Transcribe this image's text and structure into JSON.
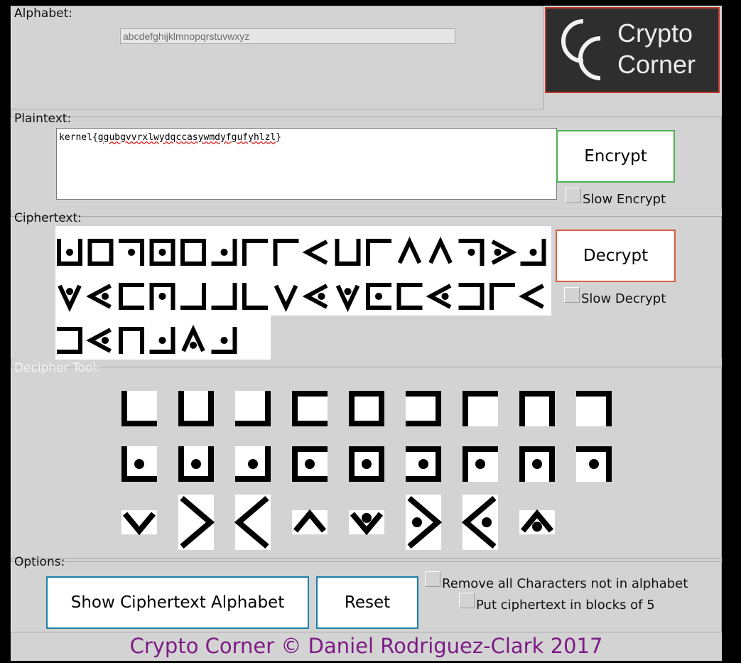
{
  "alphabet": {
    "label": "Alphabet:",
    "value": "abcdefghijklmnopqrstuvwxyz"
  },
  "logo": {
    "line1": "Crypto",
    "line2": "Corner"
  },
  "plaintext": {
    "label": "Plaintext:",
    "prefix": "kernel{",
    "squiggly": "ggubgvvrxlwydqccasywmdyfgufyhlzl",
    "suffix": "}"
  },
  "encrypt": {
    "button": "Encrypt",
    "slow_label": "Slow Encrypt",
    "accent": "#4caf50"
  },
  "ciphertext": {
    "label": "Ciphertext:",
    "text": "kernel{ggubgvvrxlwydqccasywmdyfgufyhlzl}"
  },
  "decrypt": {
    "button": "Decrypt",
    "slow_label": "Slow Decrypt",
    "accent": "#e05a4a"
  },
  "decipher_tool": {
    "label": "Decipher Tool:",
    "rows": [
      [
        "a",
        "b",
        "c",
        "d",
        "e",
        "f",
        "g",
        "h",
        "i"
      ],
      [
        "j",
        "k",
        "l",
        "m",
        "n",
        "o",
        "p",
        "q",
        "r"
      ],
      [
        "s",
        "t",
        "u",
        "v",
        "w",
        "x",
        "y",
        "z"
      ]
    ]
  },
  "options": {
    "label": "Options:",
    "show_alphabet_button": "Show Ciphertext Alphabet",
    "reset_button": "Reset",
    "remove_chars_label": "Remove all Characters not in alphabet",
    "blocks_label": "Put ciphertext in blocks of 5",
    "accent": "#1a7fa8"
  },
  "footer": {
    "text": "Crypto Corner © Daniel Rodriguez-Clark 2017",
    "color": "#7d1b86"
  }
}
